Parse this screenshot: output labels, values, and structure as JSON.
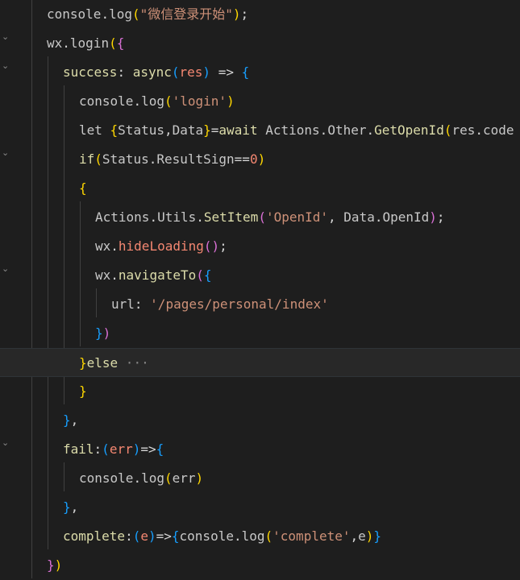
{
  "editor": {
    "lines": [
      {
        "id": "l1",
        "tokens": [
          [
            "tok-obj",
            "console"
          ],
          [
            "tok-plain",
            "."
          ],
          [
            "tok-obj",
            "log"
          ],
          [
            "tok-b1",
            "("
          ],
          [
            "tok-str",
            "\"微信登录开始\""
          ],
          [
            "tok-b1",
            ")"
          ],
          [
            "tok-plain",
            ";"
          ]
        ]
      },
      {
        "id": "l2",
        "tokens": [
          [
            "tok-obj",
            "wx"
          ],
          [
            "tok-plain",
            "."
          ],
          [
            "tok-obj",
            "login"
          ],
          [
            "tok-b1",
            "("
          ],
          [
            "tok-b2",
            "{"
          ]
        ]
      },
      {
        "id": "l3",
        "tokens": [
          [
            "tok-method",
            "success"
          ],
          [
            "tok-plain",
            ": "
          ],
          [
            "tok-method",
            "async"
          ],
          [
            "tok-b3",
            "("
          ],
          [
            "tok-red",
            "res"
          ],
          [
            "tok-b3",
            ")"
          ],
          [
            "tok-plain",
            " => "
          ],
          [
            "tok-b3",
            "{"
          ]
        ]
      },
      {
        "id": "l4",
        "tokens": [
          [
            "tok-obj",
            "console"
          ],
          [
            "tok-plain",
            "."
          ],
          [
            "tok-obj",
            "log"
          ],
          [
            "tok-b1",
            "("
          ],
          [
            "tok-str",
            "'login'"
          ],
          [
            "tok-b1",
            ")"
          ]
        ]
      },
      {
        "id": "l5",
        "tokens": [
          [
            "tok-obj",
            "let "
          ],
          [
            "tok-b1",
            "{"
          ],
          [
            "tok-obj",
            "Status"
          ],
          [
            "tok-plain",
            ","
          ],
          [
            "tok-obj",
            "Data"
          ],
          [
            "tok-b1",
            "}"
          ],
          [
            "tok-plain",
            "="
          ],
          [
            "tok-method",
            "await"
          ],
          [
            "tok-plain",
            " "
          ],
          [
            "tok-obj",
            "Actions"
          ],
          [
            "tok-plain",
            "."
          ],
          [
            "tok-obj",
            "Other"
          ],
          [
            "tok-plain",
            "."
          ],
          [
            "tok-method",
            "GetOpenId"
          ],
          [
            "tok-b1",
            "("
          ],
          [
            "tok-obj",
            "res"
          ],
          [
            "tok-plain",
            "."
          ],
          [
            "tok-obj",
            "code"
          ]
        ]
      },
      {
        "id": "l6",
        "tokens": [
          [
            "tok-method",
            "if"
          ],
          [
            "tok-b1",
            "("
          ],
          [
            "tok-obj",
            "Status"
          ],
          [
            "tok-plain",
            "."
          ],
          [
            "tok-obj",
            "ResultSign"
          ],
          [
            "tok-plain",
            "=="
          ],
          [
            "tok-red",
            "0"
          ],
          [
            "tok-b1",
            ")"
          ]
        ]
      },
      {
        "id": "l7",
        "tokens": [
          [
            "tok-b1",
            "{"
          ]
        ]
      },
      {
        "id": "l8",
        "tokens": [
          [
            "tok-obj",
            "Actions"
          ],
          [
            "tok-plain",
            "."
          ],
          [
            "tok-obj",
            "Utils"
          ],
          [
            "tok-plain",
            "."
          ],
          [
            "tok-method",
            "SetItem"
          ],
          [
            "tok-b2",
            "("
          ],
          [
            "tok-str",
            "'OpenId'"
          ],
          [
            "tok-plain",
            ", "
          ],
          [
            "tok-obj",
            "Data"
          ],
          [
            "tok-plain",
            "."
          ],
          [
            "tok-obj",
            "OpenId"
          ],
          [
            "tok-b2",
            ")"
          ],
          [
            "tok-plain",
            ";"
          ]
        ]
      },
      {
        "id": "l9",
        "tokens": [
          [
            "tok-obj",
            "wx"
          ],
          [
            "tok-plain",
            "."
          ],
          [
            "tok-red",
            "hideLoading"
          ],
          [
            "tok-b2",
            "()"
          ],
          [
            "tok-plain",
            ";"
          ]
        ]
      },
      {
        "id": "l10",
        "tokens": [
          [
            "tok-obj",
            "wx"
          ],
          [
            "tok-plain",
            "."
          ],
          [
            "tok-method",
            "navigateTo"
          ],
          [
            "tok-b2",
            "("
          ],
          [
            "tok-b3",
            "{"
          ]
        ]
      },
      {
        "id": "l11",
        "tokens": [
          [
            "tok-obj",
            "url"
          ],
          [
            "tok-plain",
            ": "
          ],
          [
            "tok-str",
            "'/pages/personal/index'"
          ]
        ]
      },
      {
        "id": "l12",
        "tokens": [
          [
            "tok-b3",
            "}"
          ],
          [
            "tok-b2",
            ")"
          ]
        ]
      },
      {
        "id": "l13",
        "tokens": [
          [
            "tok-b1",
            "}"
          ],
          [
            "tok-method",
            "else"
          ],
          [
            "tok-ellipsis",
            " ···"
          ]
        ]
      },
      {
        "id": "l14",
        "tokens": [
          [
            "tok-b1",
            "}"
          ]
        ]
      },
      {
        "id": "l15",
        "tokens": [
          [
            "tok-b3",
            "}"
          ],
          [
            "tok-plain",
            ","
          ]
        ]
      },
      {
        "id": "l16",
        "tokens": [
          [
            "tok-method",
            "fail"
          ],
          [
            "tok-plain",
            ":"
          ],
          [
            "tok-b3",
            "("
          ],
          [
            "tok-red",
            "err"
          ],
          [
            "tok-b3",
            ")"
          ],
          [
            "tok-plain",
            "=>"
          ],
          [
            "tok-b3",
            "{"
          ]
        ]
      },
      {
        "id": "l17",
        "tokens": [
          [
            "tok-obj",
            "console"
          ],
          [
            "tok-plain",
            "."
          ],
          [
            "tok-obj",
            "log"
          ],
          [
            "tok-b1",
            "("
          ],
          [
            "tok-obj",
            "err"
          ],
          [
            "tok-b1",
            ")"
          ]
        ]
      },
      {
        "id": "l18",
        "tokens": [
          [
            "tok-b3",
            "}"
          ],
          [
            "tok-plain",
            ","
          ]
        ]
      },
      {
        "id": "l19",
        "tokens": [
          [
            "tok-method",
            "complete"
          ],
          [
            "tok-plain",
            ":"
          ],
          [
            "tok-b3",
            "("
          ],
          [
            "tok-red",
            "e"
          ],
          [
            "tok-b3",
            ")"
          ],
          [
            "tok-plain",
            "=>"
          ],
          [
            "tok-b3",
            "{"
          ],
          [
            "tok-obj",
            "console"
          ],
          [
            "tok-plain",
            "."
          ],
          [
            "tok-obj",
            "log"
          ],
          [
            "tok-b1",
            "("
          ],
          [
            "tok-str",
            "'complete'"
          ],
          [
            "tok-plain",
            ","
          ],
          [
            "tok-obj",
            "e"
          ],
          [
            "tok-b1",
            ")"
          ],
          [
            "tok-b3",
            "}"
          ]
        ]
      },
      {
        "id": "l20",
        "tokens": [
          [
            "tok-b2",
            "}"
          ],
          [
            "tok-b1",
            ")"
          ]
        ]
      }
    ],
    "current_line": 13,
    "fold_icon_collapsed": "chevron-right-icon",
    "fold_icon_expanded": "chevron-down-icon"
  }
}
